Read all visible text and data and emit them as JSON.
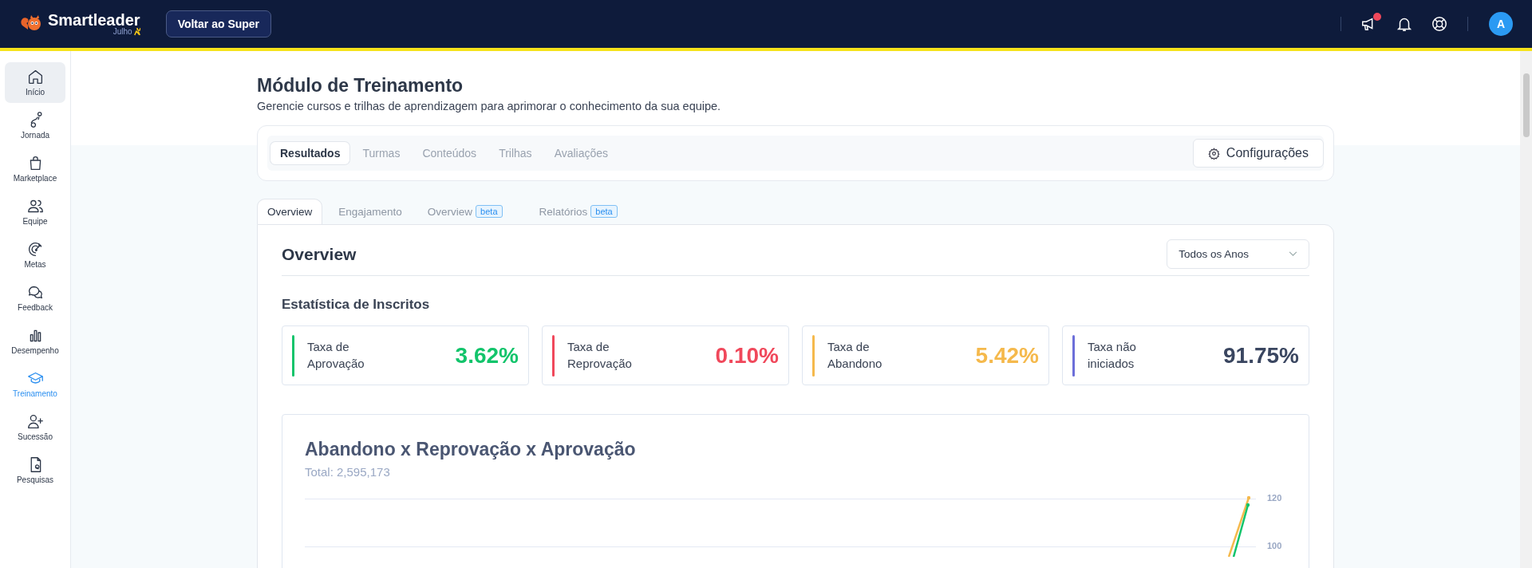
{
  "topbar": {
    "brand": "Smartleader",
    "brand_sub": "Julho",
    "back_button": "Voltar ao Super",
    "notification_dot": true,
    "avatar": "A"
  },
  "sidebar": {
    "items": [
      {
        "label": "Início",
        "selected": false,
        "hovered": true
      },
      {
        "label": "Jornada",
        "selected": false,
        "hovered": false
      },
      {
        "label": "Marketplace",
        "selected": false,
        "hovered": false
      },
      {
        "label": "Equipe",
        "selected": false,
        "hovered": false
      },
      {
        "label": "Metas",
        "selected": false,
        "hovered": false
      },
      {
        "label": "Feedback",
        "selected": false,
        "hovered": false
      },
      {
        "label": "Desempenho",
        "selected": false,
        "hovered": false
      },
      {
        "label": "Treinamento",
        "selected": true,
        "hovered": false
      },
      {
        "label": "Sucessão",
        "selected": false,
        "hovered": false
      },
      {
        "label": "Pesquisas",
        "selected": false,
        "hovered": false
      }
    ]
  },
  "page": {
    "title": "Módulo de Treinamento",
    "subtitle": "Gerencie cursos e trilhas de aprendizagem para aprimorar o conhecimento da sua equipe."
  },
  "module_tabs": [
    {
      "label": "Resultados",
      "selected": true
    },
    {
      "label": "Turmas",
      "selected": false
    },
    {
      "label": "Conteúdos",
      "selected": false
    },
    {
      "label": "Trilhas",
      "selected": false
    },
    {
      "label": "Avaliações",
      "selected": false
    }
  ],
  "settings_button": "Configurações",
  "result_tabs": [
    {
      "label": "Overview",
      "selected": true
    },
    {
      "label": "Engajamento",
      "selected": false
    },
    {
      "label": "Overview",
      "badge": "beta",
      "selected": false
    },
    {
      "label": "Relatórios",
      "badge": "beta",
      "selected": false
    }
  ],
  "overview": {
    "heading": "Overview",
    "year_select": "Todos os Anos",
    "stats_heading": "Estatística de Inscritos",
    "stats": [
      {
        "label": "Taxa de Aprovação",
        "value": "3.62%",
        "color": "#12c46b"
      },
      {
        "label": "Taxa de Reprovação",
        "value": "0.10%",
        "color": "#f0485b"
      },
      {
        "label": "Taxa de Abandono",
        "value": "5.42%",
        "color": "#f5b94c"
      },
      {
        "label": "Taxa não iniciados",
        "value": "91.75%",
        "color": "#6c6fd9"
      }
    ],
    "chart": {
      "title": "Abandono x Reprovação x Aprovação",
      "total": "Total: 2,595,173",
      "y_tick_labels": [
        "120",
        "100"
      ]
    }
  }
}
